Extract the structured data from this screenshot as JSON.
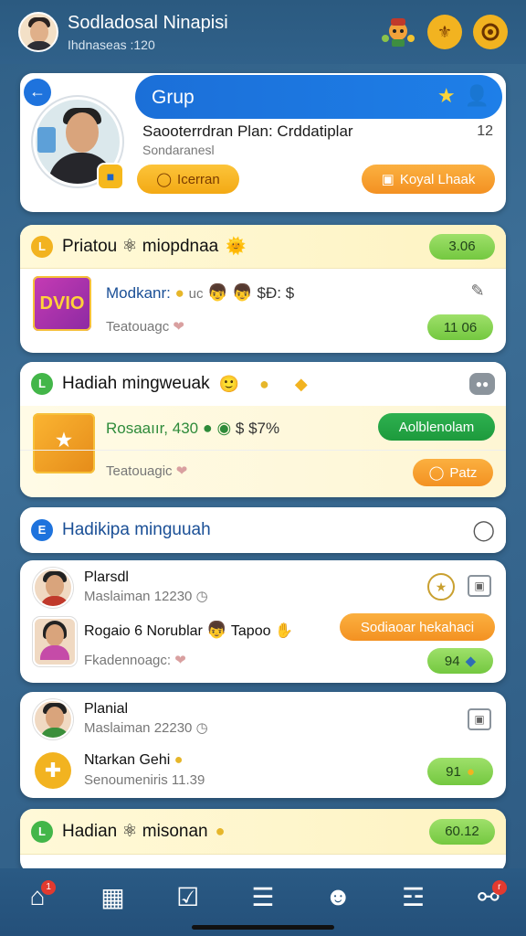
{
  "header": {
    "title": "Sodladosal Ninapisi",
    "subtitle": "Ihdnaseas :120",
    "icons": [
      "mascot-icon",
      "shield-icon",
      "target-icon"
    ]
  },
  "profile": {
    "group_label": "Grup",
    "name": "Saooterrdran Plan: Crddatiplar",
    "count": "12",
    "subtitle": "Sondaranesl",
    "button_left": "Icerran",
    "button_right": "Koyal Lhaak"
  },
  "section1": {
    "title": "Priatou ⚛ miopdnaa",
    "badge": "3.06",
    "box_label": "DVIO",
    "row1": "Modkanr:",
    "row1_tail": "uc",
    "row1_amount": "$Ð: $",
    "row2": "Teatouagc",
    "badge2": "11 06"
  },
  "section2": {
    "title": "Hadiah mingweuak",
    "row1": "Rosaaıır, 430",
    "row1_amount": "$ $7%",
    "action": "Aolblenolam",
    "row2": "Teatouagic",
    "button": "Patz"
  },
  "section3": {
    "title": "Hadikipa minguuah"
  },
  "members": [
    {
      "name": "Plarsdl",
      "sub": "Maslaiman 12230"
    },
    {
      "name": "Rogaio 6 Norublar",
      "extra": "Tapoo",
      "action": "Sodiaoar hekahaci"
    },
    {
      "row": "Fkadennoagc:",
      "badge": "94"
    }
  ],
  "members2": [
    {
      "name": "Planial",
      "sub": "Maslaiman 22230"
    },
    {
      "name": "Ntarkan Gehi",
      "sub": "Senoumeniris 11.39",
      "badge": "91"
    }
  ],
  "section4": {
    "title": "Hadian ⚛ misonan",
    "badge": "60.12"
  },
  "nav": {
    "items": [
      "home-icon",
      "gallery-icon",
      "tasks-icon",
      "menu-icon",
      "chat-icon",
      "shop-icon",
      "profile-icon"
    ],
    "badge_home": "1",
    "badge_profile": "r"
  },
  "colors": {
    "accent": "#1e73dd",
    "orange": "#f39122",
    "green": "#74c840",
    "background": "#30618a"
  }
}
